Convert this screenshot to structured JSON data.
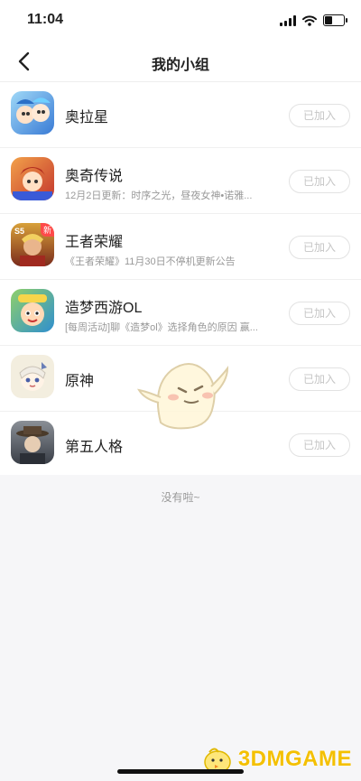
{
  "status_bar": {
    "time": "11:04"
  },
  "nav": {
    "title": "我的小组"
  },
  "groups": [
    {
      "name": "奥拉星",
      "subtitle": "",
      "button": "已加入",
      "avatar_colors": [
        "#9fd8f7",
        "#3a7bd5"
      ]
    },
    {
      "name": "奥奇传说",
      "subtitle": "12月2日更新：时序之光，昼夜女神•诺雅...",
      "button": "已加入",
      "avatar_colors": [
        "#f2a14a",
        "#c4362d"
      ]
    },
    {
      "name": "王者荣耀",
      "subtitle": "《王者荣耀》11月30日不停机更新公告",
      "button": "已加入",
      "avatar_colors": [
        "#d8a13a",
        "#7a2b1c"
      ],
      "badge": "新"
    },
    {
      "name": "造梦西游OL",
      "subtitle": "[每周活动]聊《造梦ol》选择角色的原因 赢...",
      "button": "已加入",
      "avatar_colors": [
        "#8fd06a",
        "#2f8fcf"
      ]
    },
    {
      "name": "原神",
      "subtitle": "",
      "button": "已加入",
      "avatar_colors": [
        "#f3eedf",
        "#6a7fb7"
      ]
    },
    {
      "name": "第五人格",
      "subtitle": "",
      "button": "已加入",
      "avatar_colors": [
        "#8a8f96",
        "#3a3f48"
      ]
    }
  ],
  "empty_note": "没有啦~",
  "watermark": {
    "text": "3DMGAME"
  },
  "colors": {
    "accent": "#f4c000",
    "muted": "#c6c6c6"
  }
}
